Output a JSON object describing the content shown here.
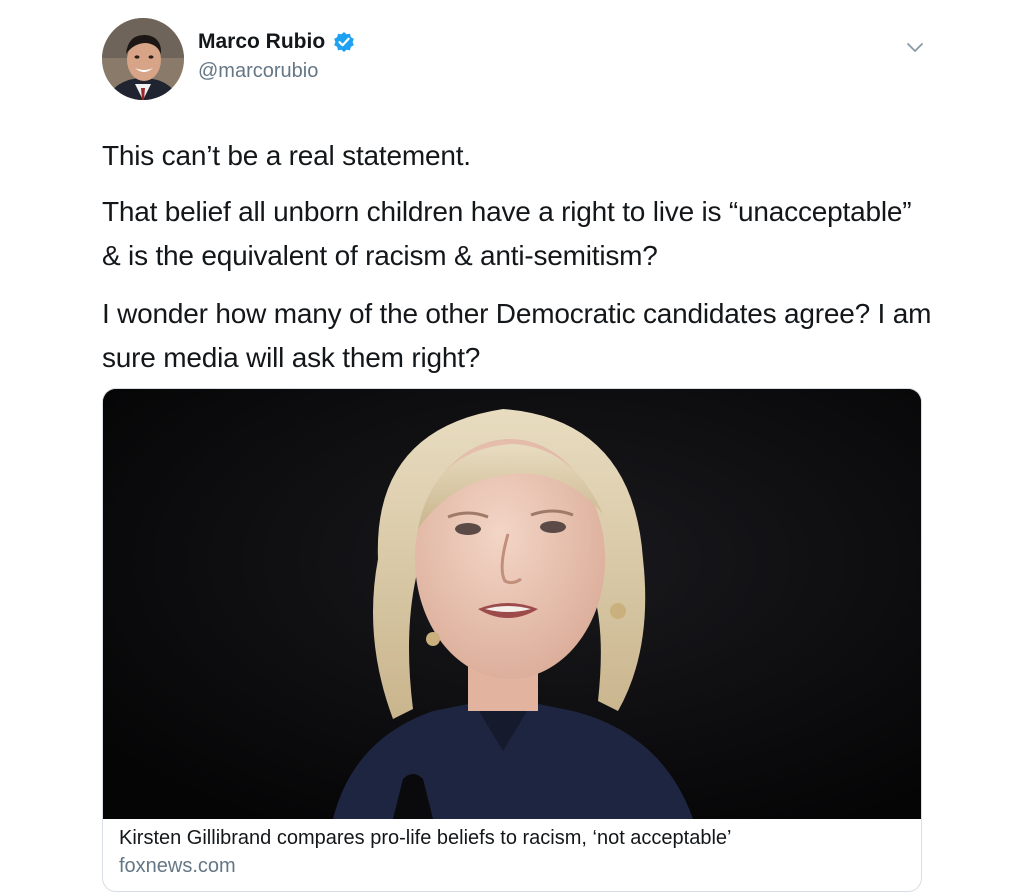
{
  "author": {
    "name": "Marco Rubio",
    "handle": "@marcorubio",
    "verified": true,
    "avatar_icon": "user-avatar-photo"
  },
  "tweet": {
    "paragraphs": [
      "This can’t be a real statement.",
      "That belief all unborn children have a right to live is “unacceptable” & is the equivalent of racism & anti-semitism?",
      "I wonder how many of the other Democratic candidates agree? I am sure media will ask them right?"
    ]
  },
  "card": {
    "title": "Kirsten Gillibrand compares pro-life beliefs to racism, ‘not acceptable’",
    "domain": "foxnews.com",
    "image_icon": "news-photo"
  },
  "icons": {
    "verified": "verified-badge-icon",
    "more": "chevron-down-icon"
  },
  "colors": {
    "verified_blue": "#1da1f2",
    "text_primary": "#14171a",
    "text_secondary": "#657786",
    "card_border": "#d7dde2",
    "image_background": "#0b0b0d"
  }
}
